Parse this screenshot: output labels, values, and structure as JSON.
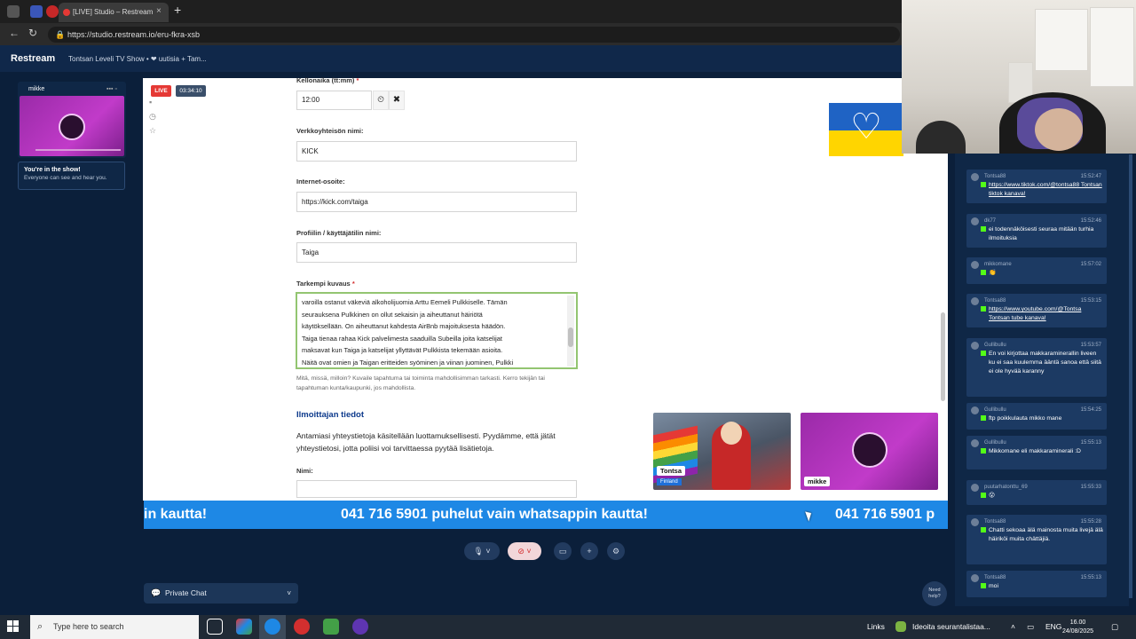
{
  "browser": {
    "tab_title": "[LIVE] Studio – Restream",
    "tab_close": "×",
    "new_tab": "+",
    "url": "https://studio.restream.io/eru-fkra-xsb",
    "back": "←",
    "reload": "↻"
  },
  "app": {
    "brand": "Restream",
    "show_title": "Tontsan Leveli TV Show • ❤ uutisia + Tam...",
    "live_badge": "LIVE",
    "timer": "03:34:10"
  },
  "sidebar": {
    "user_name": "mikke",
    "signal": "▪▪▪ ▫",
    "notice_title": "You're in the show!",
    "notice_body": "Everyone can see and hear you."
  },
  "form": {
    "time_label": "Kellonaika (tt:mm)",
    "time_value": "12:00",
    "required_mark": "*",
    "clock_btn": "⏲",
    "clear_btn": "✖",
    "community_label": "Verkkoyhteisön nimi:",
    "community_value": "KICK",
    "url_label": "Internet-osoite:",
    "url_value": "https://kick.com/taiga",
    "profile_label": "Profiilin / käyttäjätilin nimi:",
    "profile_value": "Taiga",
    "desc_label": "Tarkempi kuvaus",
    "desc_lines": [
      "varoilla ostanut väkeviä alkoholijuomia Arttu Eemeli Pulkkiselle. Tämän",
      "seurauksena Pulkkinen on ollut sekaisin ja aiheuttanut häiriötä",
      "käytöksellään. On aiheuttanut kahdesta AirBnb majoituksesta häädön.",
      "Taiga tienaa rahaa Kick palvelimesta saaduilla Subeilla joita katselijat",
      "maksavat kun Taiga ja katselijat yllyttävät Pulkkista tekemään asioita.",
      "Näitä ovat omien ja Taigan eritteiden syöminen ja viinan juominen, Pulkki"
    ],
    "hint": "Mitä, missä, milloin? Kuvaile tapahtuma tai toiminta mahdollisimman tarkasti. Kerro tekijän tai tapahtuman kunta/kaupunki, jos mahdollista.",
    "section_title": "Ilmoittajan tiedot",
    "section_text": "Antamiasi yhteystietoja käsitellään luottamuksellisesti. Pyydämme, että jätät yhteystietosi, jotta poliisi voi tarvittaessa pyytää lisätietoja.",
    "name_label": "Nimi:"
  },
  "tiles": {
    "guest1_name": "Tontsa",
    "guest1_country": "Finland",
    "guest2_name": "mikke"
  },
  "ticker": {
    "left": "in kautta!",
    "center": "041 716 5901 puhelut vain whatsappin kautta!",
    "right": "041 716 5901 p"
  },
  "controls": {
    "mic": "🎙 ˅",
    "cam": "⊘ ˅",
    "screen": "▭",
    "add": "+",
    "settings": "⚙",
    "private_chat": "Private Chat",
    "private_chat_icon": "💬",
    "chevron": "˅",
    "need_help": "Need help?"
  },
  "chat": {
    "messages": [
      {
        "user": "Tontsa88",
        "time": "15:52:47",
        "text": "https://www.tiktok.com/@tontsa88 Tontsan tiktok kanava!",
        "link": true
      },
      {
        "user": "dk77",
        "time": "15:52:46",
        "text": "ei todennäköisesti seuraa mitään turhia ilmoituksia",
        "link": false
      },
      {
        "user": "mikkomane",
        "time": "15:57:02",
        "text": "👏",
        "link": false
      },
      {
        "user": "Tontsa88",
        "time": "15:53:15",
        "text": "https://www.youtube.com/@Tontsa Tontsan tube kanava!",
        "link": true
      },
      {
        "user": "Gullibullu",
        "time": "15:53:57",
        "text": "En voi kirjottaa makkaraminerallin liveen ku ei saa kuulemma ääntä sanoa että siitä ei ole hyvää karanny",
        "link": false
      },
      {
        "user": "Gullibullu",
        "time": "15:54:25",
        "text": "ftp poikkulauta mikko mane",
        "link": false
      },
      {
        "user": "Gullibullu",
        "time": "15:55:13",
        "text": "Mikkomane eli makkaraminerali :D",
        "link": false
      },
      {
        "user": "puutarhatonttu_69",
        "time": "15:55:33",
        "text": "😮",
        "link": false
      },
      {
        "user": "Tontsa88",
        "time": "15:55:28",
        "text": "Chatti sekoaa älä mainosta muita livejä älä häiriköi muita chättäjiä.",
        "link": false
      },
      {
        "user": "Tontsa88",
        "time": "15:55:13",
        "text": "moi",
        "link": false
      }
    ]
  },
  "taskbar": {
    "search_placeholder": "Type here to search",
    "links": "Links",
    "notification": "Ideoita seurantalistaa...",
    "lang": "ENG",
    "time": "16.00",
    "date": "24/08/2025"
  },
  "colors": {
    "stage_bg": "#ffffff",
    "ticker": "#1e88e5",
    "app_bg": "#0b1f3a",
    "live": "#e53935",
    "kick_green": "#53fc18"
  }
}
